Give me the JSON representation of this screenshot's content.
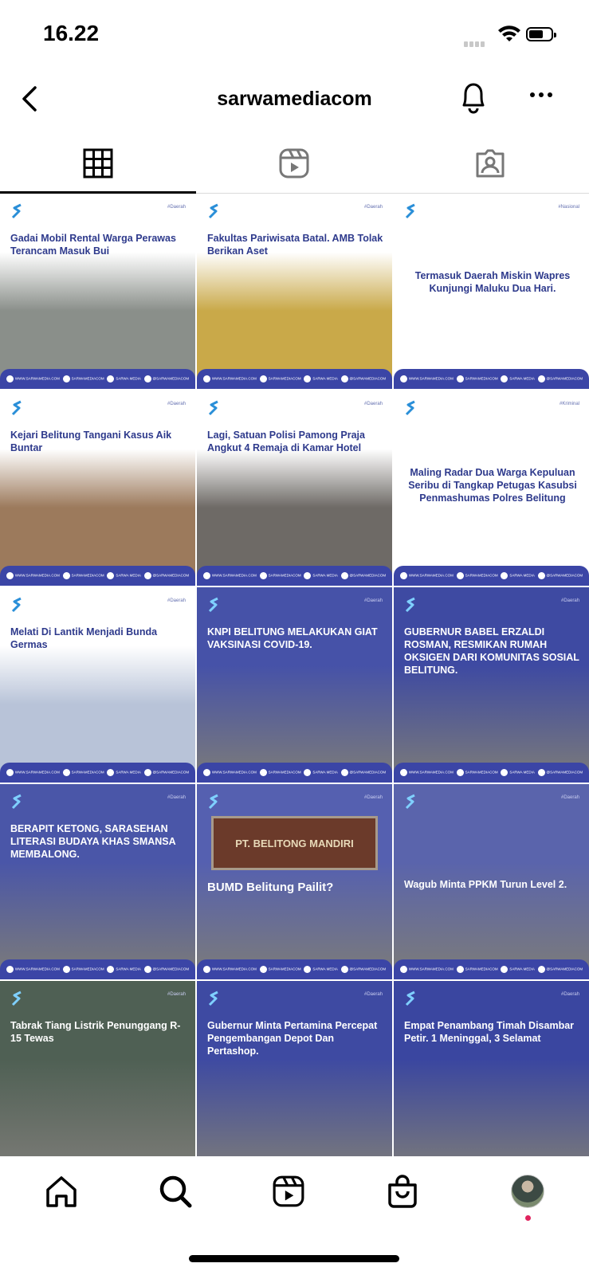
{
  "status_bar": {
    "time": "16.22"
  },
  "header": {
    "username": "sarwamediacom"
  },
  "tabs": [
    {
      "name": "grid",
      "icon": "grid-icon",
      "active": true
    },
    {
      "name": "reels",
      "icon": "reels-icon",
      "active": false
    },
    {
      "name": "tagged",
      "icon": "tagged-person-icon",
      "active": false
    }
  ],
  "posts": [
    {
      "tag": "#Daerah",
      "headline": "Gadai Mobil Rental Warga Perawas Terancam Masuk Bui",
      "style": "dark",
      "bg": "#8a8f8a"
    },
    {
      "tag": "#Daerah",
      "headline": "Fakultas Pariwisata Batal. AMB Tolak Berikan Aset",
      "style": "dark",
      "bg": "#c9a949"
    },
    {
      "tag": "#Nasional",
      "headline": "Termasuk Daerah Miskin Wapres Kunjungi Maluku Dua Hari.",
      "style": "dark",
      "bg": "#ffffff"
    },
    {
      "tag": "#Daerah",
      "headline": "Kejari Belitung Tangani Kasus Aik Buntar",
      "style": "dark",
      "bg": "#9c7a5c"
    },
    {
      "tag": "#Daerah",
      "headline": "Lagi, Satuan Polisi Pamong Praja Angkut 4 Remaja di Kamar Hotel",
      "style": "dark",
      "bg": "#6e6a66"
    },
    {
      "tag": "#Kriminal",
      "headline": "Maling Radar Dua Warga Kepuluan Seribu di Tangkap Petugas Kasubsi Penmashumas Polres Belitung",
      "style": "dark",
      "bg": "#ffffff"
    },
    {
      "tag": "#Daerah",
      "headline": "Melati Di Lantik Menjadi Bunda Germas",
      "style": "dark",
      "bg": "#b8c3d8"
    },
    {
      "tag": "#Daerah",
      "headline": "KNPI BELITUNG MELAKUKAN GIAT VAKSINASI COVID-19.",
      "style": "light",
      "bg": "#4652a8"
    },
    {
      "tag": "#Daerah",
      "headline": "GUBERNUR BABEL ERZALDI ROSMAN, RESMIKAN RUMAH OKSIGEN DARI KOMUNITAS SOSIAL BELITUNG.",
      "style": "light",
      "bg": "#3e4aa2"
    },
    {
      "tag": "#Daerah",
      "headline": "BERAPIT KETONG, SARASEHAN LITERASI BUDAYA KHAS SMANSA MEMBALONG.",
      "style": "light",
      "bg": "#4a56a8"
    },
    {
      "tag": "#Daerah",
      "headline": "BUMD Belitung Pailit?",
      "style": "light",
      "bg": "#5560b0",
      "sign": "PT. BELITONG MANDIRI"
    },
    {
      "tag": "#Daerah",
      "headline": "Wagub Minta PPKM Turun Level 2.",
      "style": "light",
      "bg": "#5a64ac"
    },
    {
      "tag": "#Daerah",
      "headline": "Tabrak Tiang Listrik Penunggang R- 15 Tewas",
      "style": "light",
      "bg": "#4f6054"
    },
    {
      "tag": "#Daerah",
      "headline": "Gubernur Minta Pertamina Percepat Pengembangan Depot Dan Pertashop.",
      "style": "light",
      "bg": "#3e4aa2"
    },
    {
      "tag": "#Daerah",
      "headline": "Empat Penambang Timah Disambar Petir. 1 Meninggal, 3 Selamat",
      "style": "light",
      "bg": "#3a46a0"
    }
  ],
  "post_footer": {
    "website": "WWW.SARWAMEDIA.COM",
    "instagram": "SARWAMEDIACOM",
    "facebook": "SARWA MEDIA",
    "twitter": "@SARWAMEDIACOM"
  },
  "bottom_nav": [
    {
      "name": "home",
      "icon": "home-icon"
    },
    {
      "name": "search",
      "icon": "search-icon"
    },
    {
      "name": "reels",
      "icon": "reels-icon"
    },
    {
      "name": "shop",
      "icon": "shopping-bag-icon"
    },
    {
      "name": "profile",
      "icon": "avatar"
    }
  ]
}
